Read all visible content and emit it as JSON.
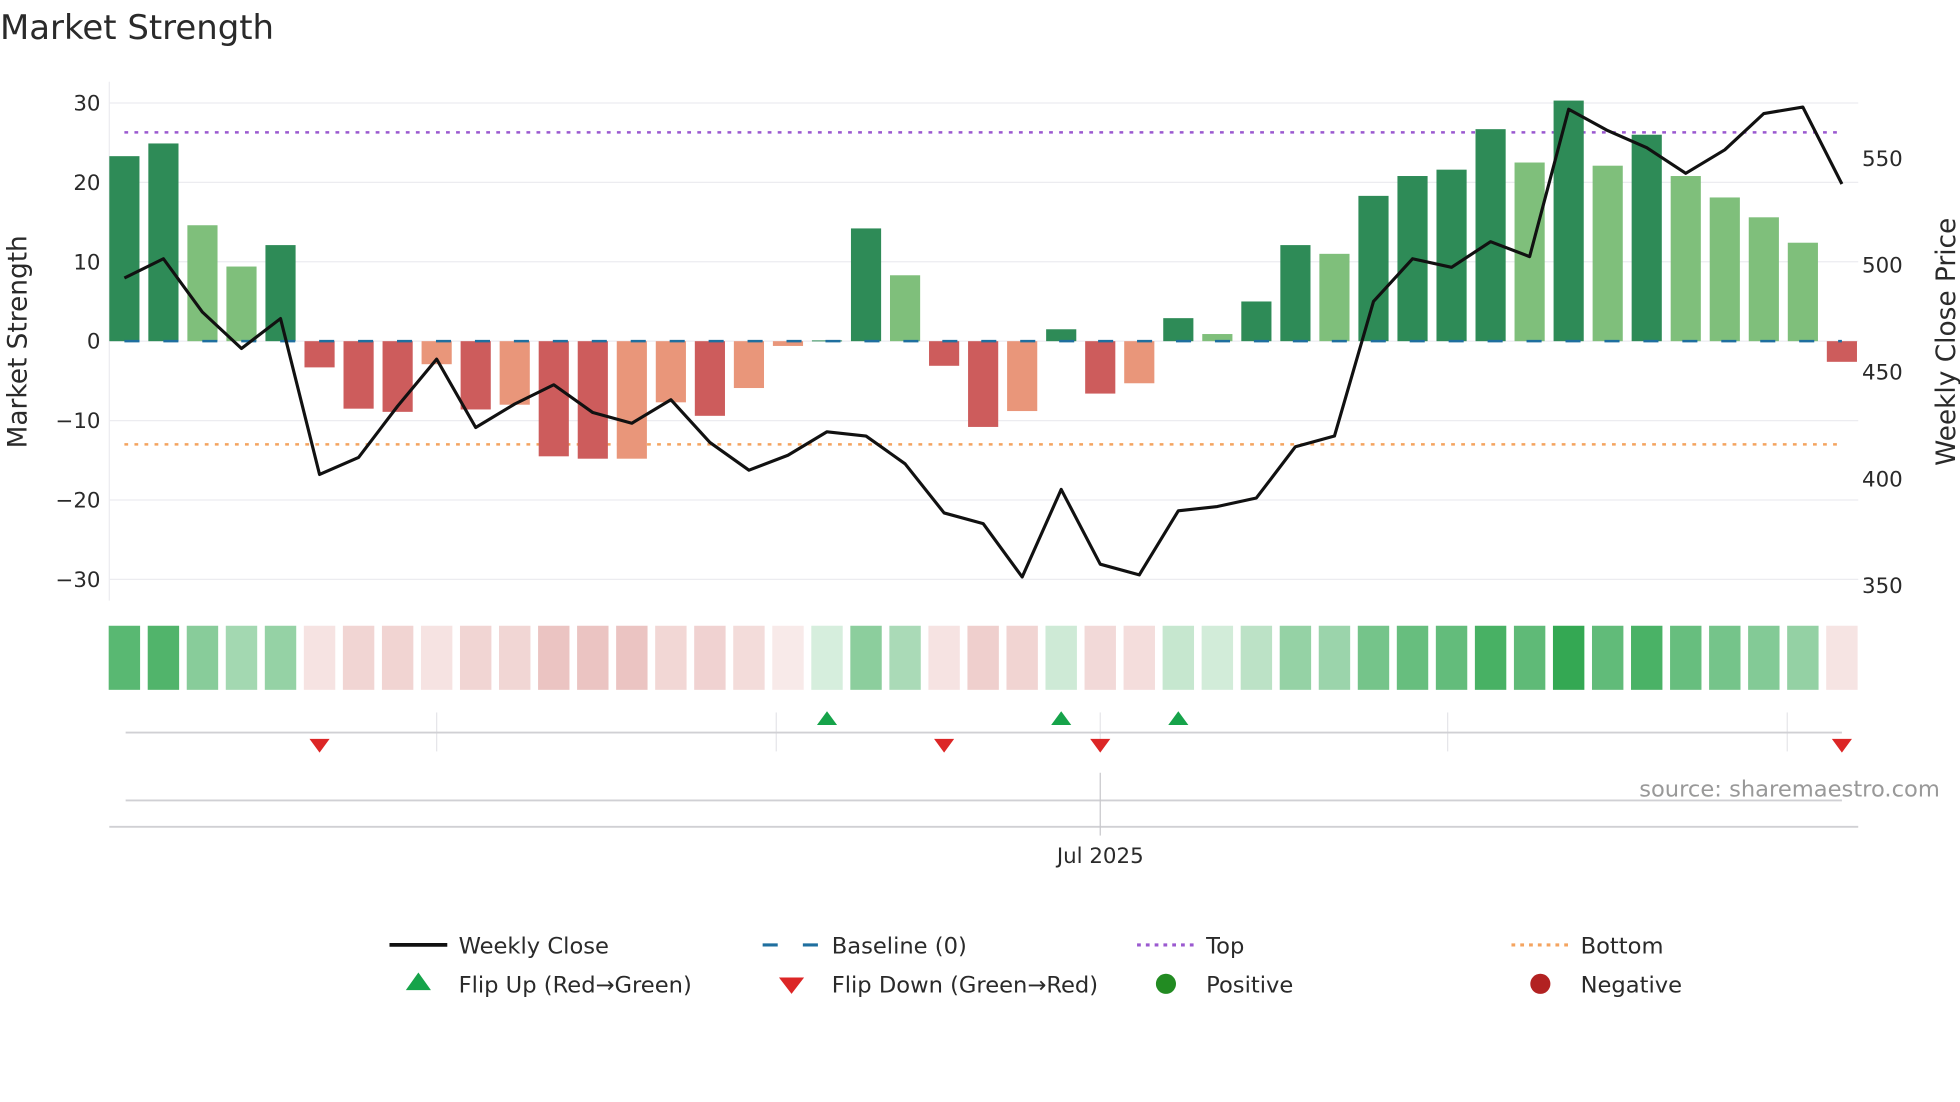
{
  "chart_data": {
    "type": "bar",
    "title": "Market Strength",
    "ylabel": "Market Strength",
    "y2label": "Weekly Close Price",
    "ylim": [
      -33,
      33
    ],
    "y2lim": [
      340,
      580
    ],
    "yticks": [
      "30",
      "20",
      "10",
      "0",
      "−10",
      "−20",
      "−30"
    ],
    "ytick_values": [
      30,
      20,
      10,
      0,
      -10,
      -20,
      -30
    ],
    "y2ticks": [
      "550",
      "500",
      "450",
      "400",
      "350"
    ],
    "y2tick_values": [
      550,
      500,
      450,
      400,
      350
    ],
    "xtick_label": "Jul 2025",
    "xtick_index": 25,
    "month_grid_indices": [
      8,
      16.7,
      25,
      33.9,
      42.6
    ],
    "top_level": 26.3,
    "bottom_level": -13,
    "baseline": 0,
    "strength": [
      23.3,
      24.9,
      14.6,
      9.4,
      12.1,
      -3.3,
      -8.5,
      -8.9,
      -2.9,
      -8.6,
      -8.0,
      -14.5,
      -14.8,
      -14.8,
      -7.7,
      -9.4,
      -5.9,
      -0.6,
      0.1,
      14.2,
      8.3,
      -3.1,
      -10.8,
      -8.8,
      1.5,
      -6.6,
      -5.3,
      2.9,
      0.9,
      5.0,
      12.1,
      11.0,
      18.3,
      20.8,
      21.6,
      26.7,
      22.5,
      30.3,
      22.1,
      26.0,
      20.8,
      18.1,
      15.6,
      12.4,
      -2.6
    ],
    "bar_shade": [
      "dark",
      "dark",
      "light",
      "light",
      "dark",
      "dark",
      "dark",
      "dark",
      "light",
      "dark",
      "light",
      "dark",
      "dark",
      "light",
      "light",
      "dark",
      "light",
      "light",
      "dark",
      "dark",
      "light",
      "dark",
      "dark",
      "light",
      "dark",
      "dark",
      "light",
      "dark",
      "light",
      "dark",
      "dark",
      "light",
      "dark",
      "dark",
      "dark",
      "dark",
      "light",
      "dark",
      "light",
      "dark",
      "light",
      "light",
      "light",
      "light",
      "dark"
    ],
    "weekly_close": [
      494,
      503,
      478,
      461,
      475,
      402,
      410,
      434,
      456,
      424,
      435,
      444,
      431,
      426,
      437,
      417,
      404,
      411,
      422,
      420,
      407,
      384,
      379,
      354,
      395,
      360,
      355,
      385,
      387,
      391,
      415,
      420,
      483,
      503,
      499,
      511,
      504,
      573,
      563,
      555,
      543,
      554,
      571,
      574,
      538
    ],
    "flips": [
      {
        "index": 5,
        "dir": "down"
      },
      {
        "index": 18,
        "dir": "up"
      },
      {
        "index": 21,
        "dir": "down"
      },
      {
        "index": 24,
        "dir": "up"
      },
      {
        "index": 25,
        "dir": "down"
      },
      {
        "index": 27,
        "dir": "up"
      },
      {
        "index": 44,
        "dir": "down"
      }
    ],
    "legend": [
      {
        "key": "close",
        "label": "Weekly Close"
      },
      {
        "key": "baseline",
        "label": "Baseline (0)"
      },
      {
        "key": "top",
        "label": "Top"
      },
      {
        "key": "bottom",
        "label": "Bottom"
      },
      {
        "key": "flipup",
        "label": "Flip Up (Red→Green)"
      },
      {
        "key": "flipdown",
        "label": "Flip Down (Green→Red)"
      },
      {
        "key": "positive",
        "label": "Positive"
      },
      {
        "key": "negative",
        "label": "Negative"
      }
    ],
    "legend_placement": "bottom",
    "source": "source: sharemaestro.com",
    "colors": {
      "pos_dark": "#2e8b57",
      "pos_light": "#7fbf7b",
      "neg_dark": "#cd5c5c",
      "neg_light": "#e9967a",
      "close": "#111111",
      "baseline": "#1f6f9f",
      "top": "#9b59d0",
      "bottom": "#f4a460",
      "flipup": "#16a34a",
      "flipdown": "#dc2626",
      "positive": "#228b22",
      "negative": "#b22222",
      "strip_pos": "#34a853",
      "strip_neg": "#d88a85"
    }
  }
}
